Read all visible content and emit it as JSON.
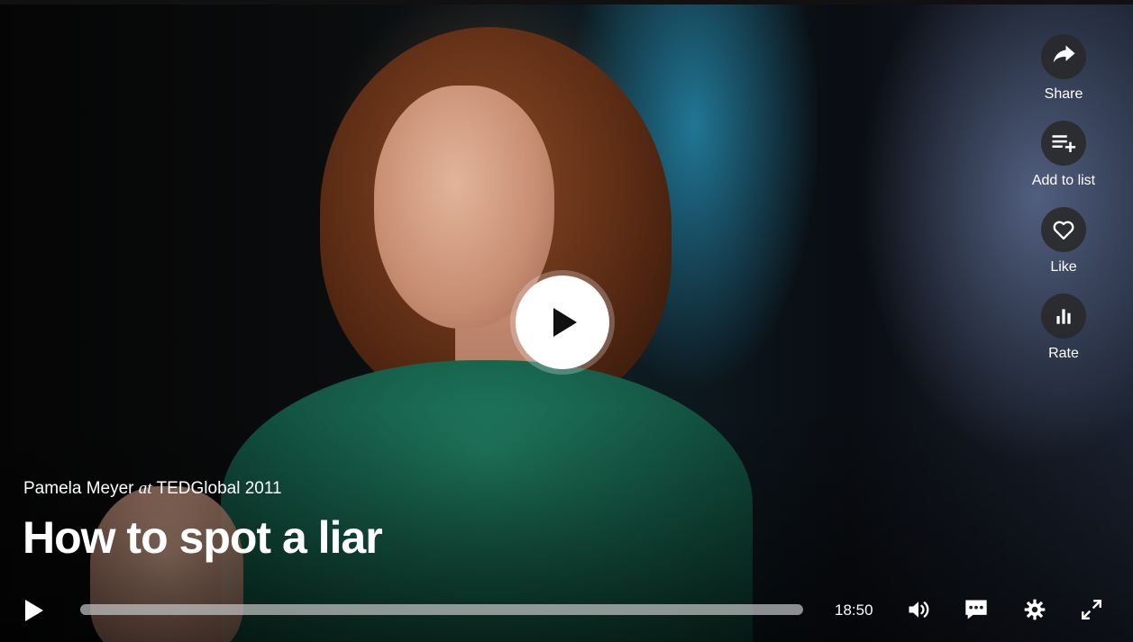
{
  "talk": {
    "speaker": "Pamela Meyer",
    "at": "at",
    "event": "TEDGlobal 2011",
    "title": "How to spot a liar"
  },
  "actions": [
    {
      "label": "Share",
      "icon": "share-icon"
    },
    {
      "label": "Add to list",
      "icon": "playlist-add-icon"
    },
    {
      "label": "Like",
      "icon": "heart-icon"
    },
    {
      "label": "Rate",
      "icon": "bar-chart-icon"
    }
  ],
  "controls": {
    "duration": "18:50",
    "progress": 0,
    "icons": [
      "play-icon",
      "volume-icon",
      "subtitles-icon",
      "settings-icon",
      "fullscreen-icon"
    ]
  },
  "colors": {
    "accent": "#ffffff",
    "action_button_bg": "#282828",
    "jacket": "#1f7a5e"
  }
}
